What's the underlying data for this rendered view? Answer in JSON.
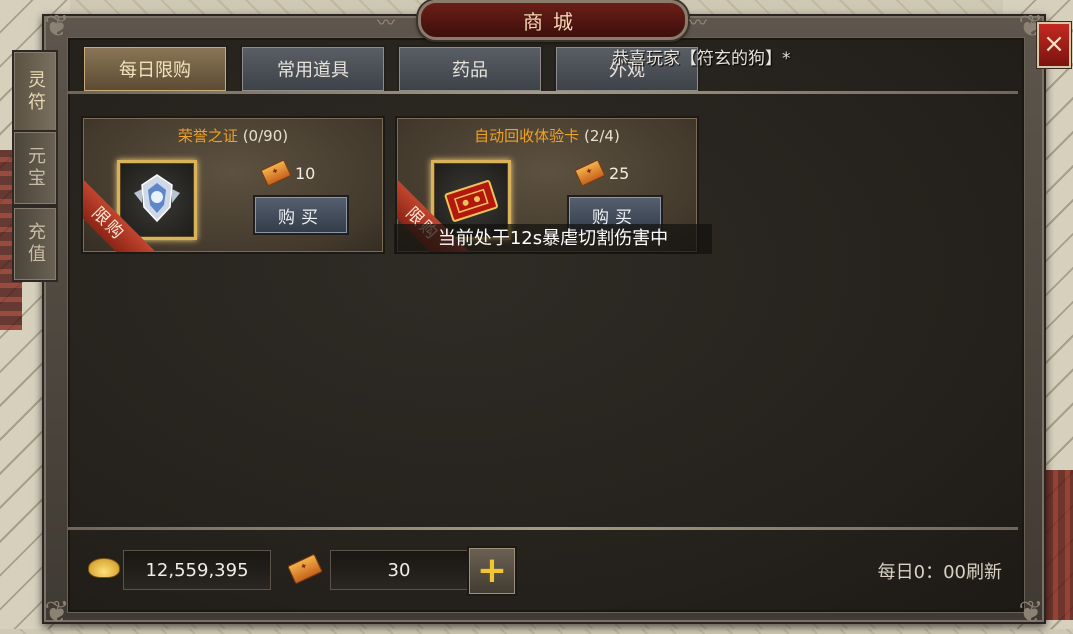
{
  "title": "商城",
  "close_label": "×",
  "side_tabs": [
    {
      "label": "灵符",
      "active": true
    },
    {
      "label": "元宝",
      "active": false
    },
    {
      "label": "充值",
      "active": false
    }
  ],
  "categories": [
    {
      "label": "每日限购",
      "active": true
    },
    {
      "label": "常用道具",
      "active": false
    },
    {
      "label": "药品",
      "active": false
    },
    {
      "label": "外观",
      "active": false
    }
  ],
  "broadcast": "恭喜玩家【符玄的狗】*",
  "items": [
    {
      "name": "荣誉之证",
      "count": "(0/90)",
      "price": "10",
      "badge": "限购",
      "buy_label": "购买",
      "icon": "honor-emblem-icon"
    },
    {
      "name": "自动回收体验卡",
      "count": "(2/4)",
      "price": "25",
      "badge": "限购",
      "buy_label": "购买",
      "icon": "recycle-card-icon"
    }
  ],
  "toast": "当前处于12s暴虐切割伤害中",
  "footer": {
    "ingot_amount": "12,559,395",
    "coupon_amount": "30",
    "plus_label": "+",
    "refresh_note": "每日0：00刷新"
  },
  "colors": {
    "item_name": "#f0a126",
    "title_plate": "#6b1e18",
    "close_button": "#c32a22",
    "plus_icon": "#f3c531"
  }
}
